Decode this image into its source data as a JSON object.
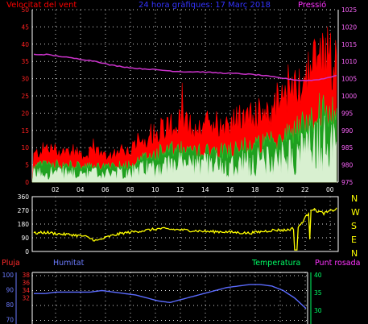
{
  "title": "24 hora gràfiques: 17 Març 2018",
  "colors": {
    "background": "#000000",
    "wind": "#ff0000",
    "wind_avg": "#1fa01f",
    "wind_light": "#d8f0d0",
    "pressure": "#cc33cc",
    "direction": "#ffff00",
    "humidity": "#5b6bff",
    "temperature": "#00ff66",
    "dewpoint": "#ff33ff",
    "rain": "#ff2a2a",
    "grid": "#ffffff",
    "axis": "#ffffff"
  },
  "top_panel": {
    "left_label": "Velocitat del vent",
    "right_label": "Pressió",
    "left_ticks": [
      "50",
      "45",
      "40",
      "35",
      "30",
      "25",
      "20",
      "15",
      "10",
      "5",
      "0"
    ],
    "right_ticks": [
      "1025",
      "1020",
      "1015",
      "1010",
      "1005",
      "1000",
      "995",
      "990",
      "985",
      "980",
      "975"
    ],
    "x_ticks": [
      "02",
      "04",
      "06",
      "08",
      "10",
      "12",
      "14",
      "16",
      "18",
      "20",
      "22",
      "00"
    ]
  },
  "mid_panel": {
    "left_ticks": [
      "360",
      "270",
      "180",
      "90",
      "0"
    ],
    "cardinals": [
      "N",
      "W",
      "S",
      "E",
      "N"
    ]
  },
  "bottom_panel": {
    "labels": {
      "rain": "Pluja",
      "humidity": "Humitat",
      "temperature": "Temperatura",
      "dewpoint": "Punt rosada"
    },
    "left_ticks": [
      "100",
      "90",
      "80",
      "70"
    ],
    "left2_ticks": [
      "38",
      "36",
      "34",
      "32"
    ],
    "right_ticks": [
      "40",
      "35",
      "30"
    ]
  },
  "chart_data": [
    {
      "type": "line",
      "title": "24 hora gràfiques: 17 Març 2018",
      "ylabel": "Velocitat del vent",
      "y2label": "Pressió",
      "x_ticks": [
        "02",
        "04",
        "06",
        "08",
        "10",
        "12",
        "14",
        "16",
        "18",
        "20",
        "22",
        "00"
      ],
      "ylim": [
        0,
        50
      ],
      "y2lim": [
        975,
        1025
      ],
      "series": [
        {
          "x": [
            0,
            1,
            2,
            3,
            4,
            5,
            6,
            7,
            8,
            9,
            10,
            11,
            12,
            13,
            14,
            15,
            16,
            17,
            18,
            19,
            20,
            21,
            22,
            23,
            24
          ],
          "values": [
            7,
            9,
            8,
            8,
            7,
            8,
            7,
            8,
            9,
            12,
            14,
            15,
            15,
            14,
            16,
            15,
            16,
            17,
            18,
            19,
            22,
            25,
            30,
            35,
            30
          ]
        },
        {
          "name": "Pressió",
          "x": [
            0,
            1,
            2,
            3,
            4,
            5,
            6,
            7,
            8,
            9,
            10,
            11,
            12,
            13,
            14,
            15,
            16,
            17,
            18,
            19,
            20,
            21,
            22,
            23,
            24
          ],
          "values": [
            1012,
            1012,
            1011.5,
            1011,
            1010.5,
            1010,
            1009,
            1008.5,
            1008,
            1007.8,
            1007.5,
            1007.2,
            1007,
            1007,
            1006.8,
            1006.6,
            1006.5,
            1006.3,
            1006,
            1005.5,
            1005,
            1004.5,
            1004.5,
            1005,
            1006
          ]
        }
      ],
      "grid": true
    },
    {
      "type": "line",
      "ylim": [
        0,
        360
      ],
      "y_ticks": [
        "360",
        "270",
        "180",
        "90",
        "0"
      ],
      "series": [
        {
          "x": [
            0,
            1,
            2,
            3,
            4,
            5,
            6,
            7,
            8,
            9,
            10,
            11,
            12,
            13,
            14,
            15,
            16,
            17,
            18,
            19,
            20,
            21,
            22,
            23,
            24
          ],
          "values": [
            120,
            125,
            115,
            110,
            100,
            70,
            100,
            120,
            130,
            140,
            150,
            145,
            140,
            135,
            130,
            130,
            125,
            120,
            130,
            140,
            140,
            160,
            280,
            250,
            280
          ]
        }
      ],
      "grid": true
    },
    {
      "type": "line",
      "y_ticks_humidity": [
        "100",
        "90",
        "80",
        "70"
      ],
      "y_ticks_temperature": [
        "40",
        "35",
        "30"
      ],
      "series": [
        {
          "name": "Humitat",
          "x": [
            0,
            1,
            2,
            3,
            4,
            5,
            6,
            7,
            8,
            9,
            10,
            11,
            12,
            13,
            14,
            15,
            16,
            17,
            18,
            19,
            20,
            21,
            22,
            23,
            24
          ],
          "values": [
            88,
            88,
            89,
            89,
            89,
            89,
            90,
            89,
            88,
            87,
            85,
            83,
            82,
            84,
            86,
            88,
            90,
            92,
            93,
            94,
            94,
            93,
            90,
            85,
            78
          ]
        }
      ],
      "grid": true
    }
  ]
}
